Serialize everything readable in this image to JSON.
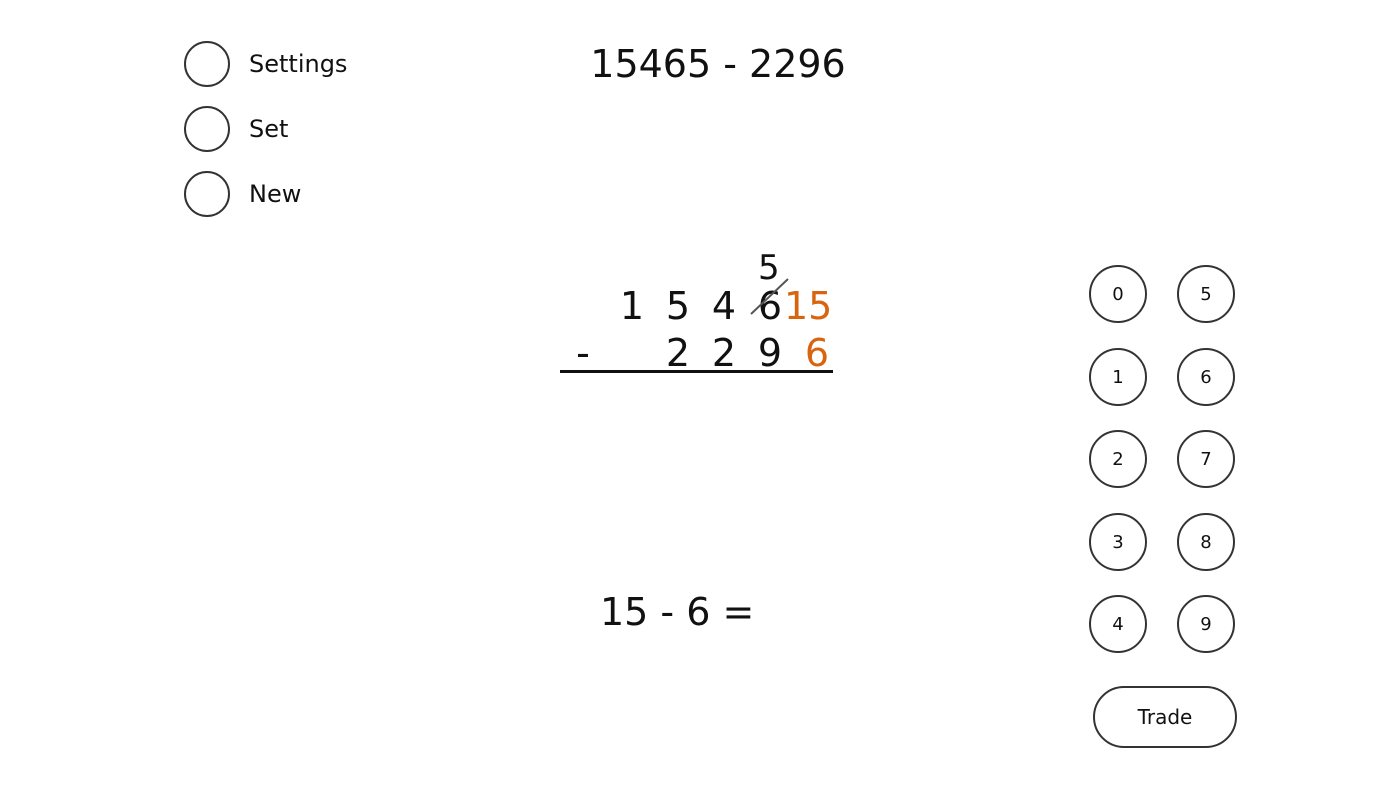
{
  "menu": {
    "settings_label": "Settings",
    "set_label": "Set",
    "new_label": "New"
  },
  "problem": "15465 - 2296",
  "work": {
    "top_digits": [
      "1",
      "5",
      "4",
      "6",
      "15"
    ],
    "borrow_mark": "5",
    "crossed_digit_index": 3,
    "operator": "-",
    "bottom_digits": [
      "",
      "2",
      "2",
      "9",
      "6"
    ]
  },
  "current_step": "15 - 6 =",
  "keypad": {
    "keys": [
      "0",
      "5",
      "1",
      "6",
      "2",
      "7",
      "3",
      "8",
      "4",
      "9"
    ],
    "trade_label": "Trade"
  },
  "colors": {
    "highlight": "#d9640f",
    "text": "#111111"
  }
}
